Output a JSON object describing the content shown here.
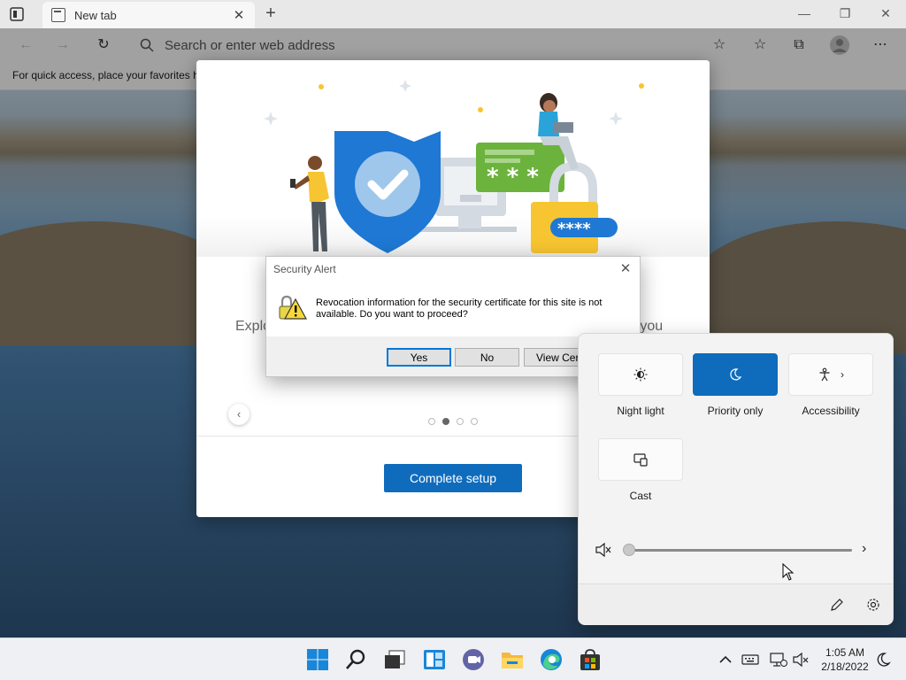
{
  "browser": {
    "tab_title": "New tab",
    "address_placeholder": "Search or enter web address",
    "favorites_bar_text": "For quick access, place your favorites h"
  },
  "welcome": {
    "explore_text": "Explo",
    "explore_text_right": "e you",
    "complete_button": "Complete setup",
    "carousel": {
      "count": 4,
      "active_index": 1
    },
    "illustration": {
      "dialog_stars": "* * *",
      "password_mask": "****"
    }
  },
  "security_alert": {
    "title": "Security Alert",
    "message": "Revocation information for the security certificate for this site is not available. Do you want to proceed?",
    "buttons": {
      "yes": "Yes",
      "no": "No",
      "view": "View Certi"
    }
  },
  "quick_settings": {
    "tiles": [
      {
        "label": "Night light",
        "icon": "brightness-icon",
        "active": false
      },
      {
        "label": "Priority only",
        "icon": "moon-icon",
        "active": true
      },
      {
        "label": "Accessibility",
        "icon": "accessibility-icon",
        "active": false
      },
      {
        "label": "Cast",
        "icon": "cast-icon",
        "active": false
      }
    ],
    "volume": {
      "level": 0,
      "muted": true
    }
  },
  "taskbar": {
    "time": "1:05 AM",
    "date": "2/18/2022",
    "apps": [
      "Start",
      "Search",
      "Task View",
      "Widgets",
      "Chat",
      "File Explorer",
      "Microsoft Edge",
      "Microsoft Store"
    ]
  },
  "colors": {
    "accent": "#0f6cbd",
    "shield": "#1e78d4",
    "green": "#6cb33e",
    "yellow": "#f7c531"
  }
}
